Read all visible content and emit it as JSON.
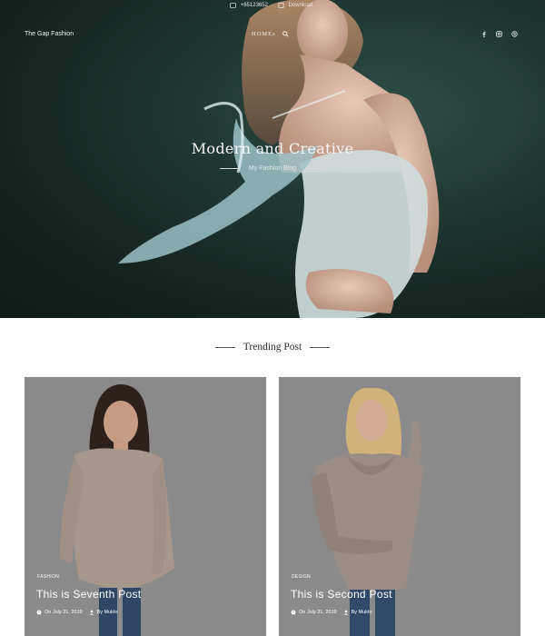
{
  "topbar": {
    "phone": "+65123652",
    "download": "Download"
  },
  "brand": "The Gap Fashion",
  "nav": {
    "home": "HOMEs"
  },
  "social": {
    "icons": [
      "facebook-icon",
      "instagram-icon",
      "skype-icon"
    ]
  },
  "hero": {
    "title": "Modern and Creative",
    "subtitle": "My Fashion Blog"
  },
  "section": {
    "title": "Trending Post"
  },
  "posts": [
    {
      "category": "FASHION",
      "title": "This is Seventh Post",
      "date": "On July 31, 2019",
      "author": "By Mukto"
    },
    {
      "category": "DESIGN",
      "title": "This is Second Post",
      "date": "On July 31, 2019",
      "author": "By Mukto"
    }
  ],
  "colors": {
    "hero_bg": "#1e3531",
    "card_bg": "#8a8a8a",
    "text_dark": "#2b2b2b"
  }
}
